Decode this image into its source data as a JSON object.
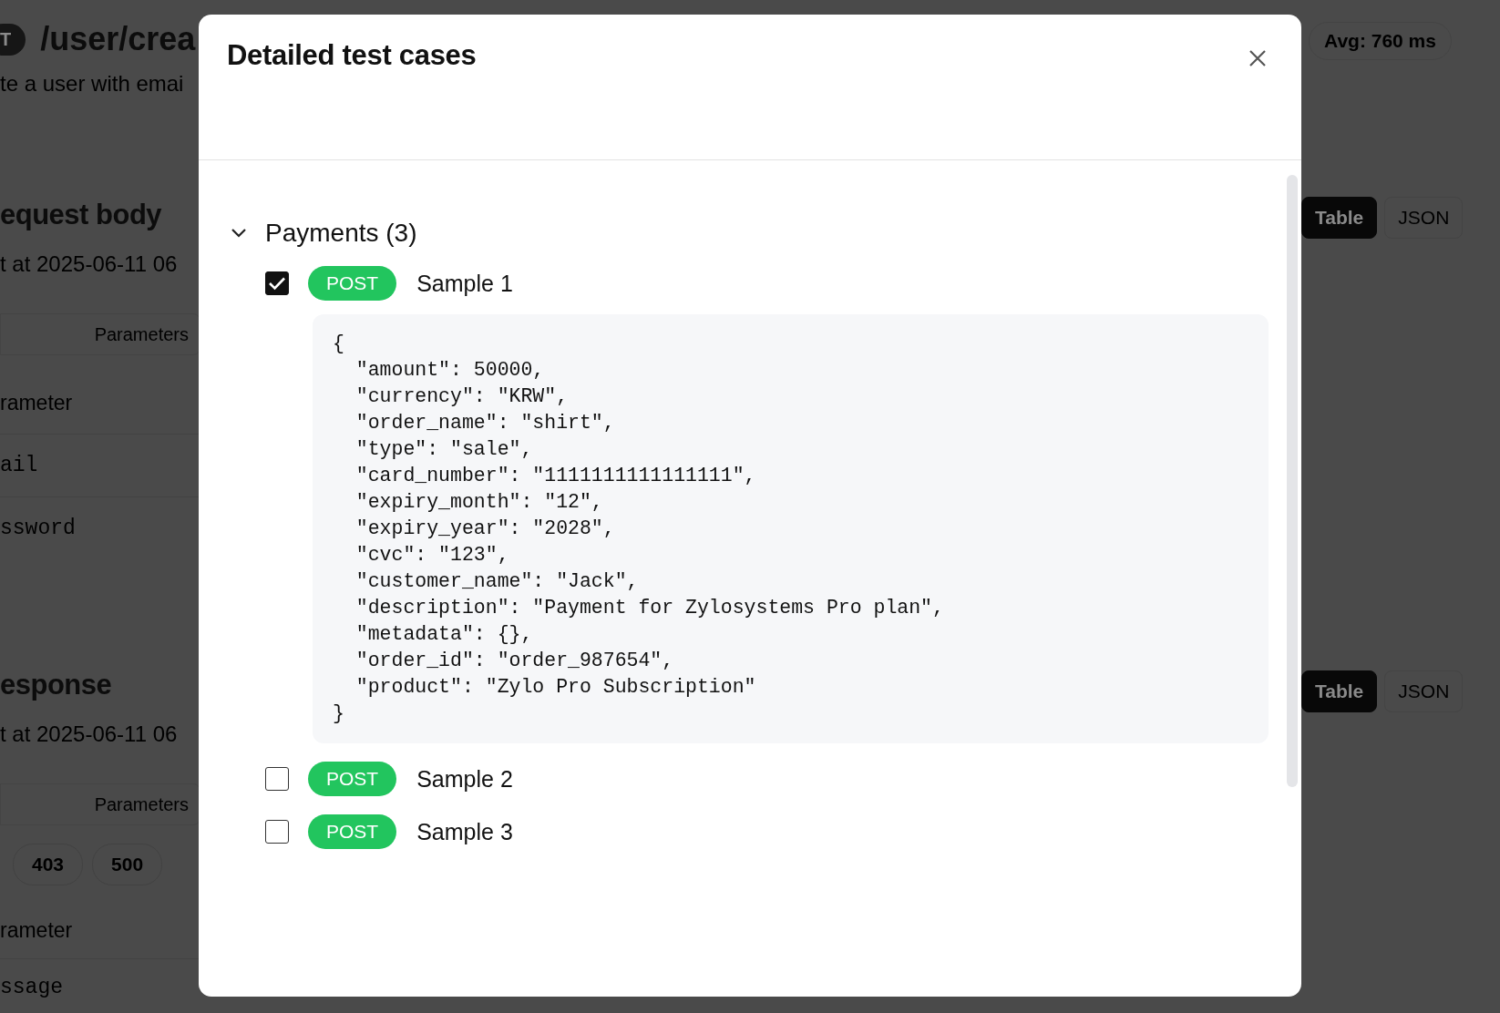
{
  "background": {
    "method_badge": "T",
    "path": "/user/crea",
    "description": "te a user with emai",
    "avg": "Avg: 760 ms",
    "sections": [
      {
        "title": "equest body",
        "timestamp": "t at 2025-06-11 06",
        "view_tabs": [
          {
            "label": "Table",
            "selected": true
          },
          {
            "label": "JSON",
            "selected": false
          }
        ],
        "column_header": "Parameters",
        "rows": [
          "rameter",
          "ail",
          "ssword"
        ]
      },
      {
        "title": "esponse",
        "timestamp": "t at 2025-06-11 06",
        "view_tabs": [
          {
            "label": "Table",
            "selected": true
          },
          {
            "label": "JSON",
            "selected": false
          }
        ],
        "column_header": "Parameters",
        "status_codes": [
          "403",
          "500"
        ],
        "rows": [
          "rameter",
          "ssage"
        ]
      }
    ]
  },
  "dialog": {
    "title": "Detailed test cases",
    "groups": [
      {
        "name": "Payments (3)",
        "expanded": true,
        "samples": [
          {
            "checked": true,
            "method": "POST",
            "name": "Sample 1",
            "body": "{\n  \"amount\": 50000,\n  \"currency\": \"KRW\",\n  \"order_name\": \"shirt\",\n  \"type\": \"sale\",\n  \"card_number\": \"1111111111111111\",\n  \"expiry_month\": \"12\",\n  \"expiry_year\": \"2028\",\n  \"cvc\": \"123\",\n  \"customer_name\": \"Jack\",\n  \"description\": \"Payment for Zylosystems Pro plan\",\n  \"metadata\": {},\n  \"order_id\": \"order_987654\",\n  \"product\": \"Zylo Pro Subscription\"\n}"
          },
          {
            "checked": false,
            "method": "POST",
            "name": "Sample 2"
          },
          {
            "checked": false,
            "method": "POST",
            "name": "Sample 3"
          }
        ]
      }
    ]
  }
}
